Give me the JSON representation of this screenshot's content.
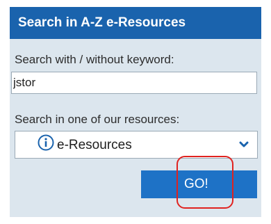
{
  "header": {
    "title": "Search in A-Z e-Resources"
  },
  "keyword": {
    "label": "Search with / without keyword:",
    "value": "jstor"
  },
  "resource": {
    "label": "Search in one of our resources:",
    "selected": "e-Resources",
    "icon": "info-icon"
  },
  "actions": {
    "go_label": "GO!"
  },
  "colors": {
    "header_bg": "#1a63ad",
    "panel_bg": "#dce6ee",
    "button_bg": "#1e72c6",
    "annotation": "#e0221f"
  }
}
